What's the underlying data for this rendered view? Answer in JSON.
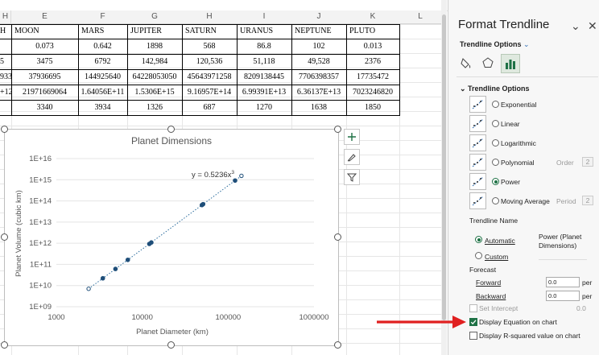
{
  "columns": [
    "H",
    "E",
    "F",
    "G",
    "H",
    "I",
    "J",
    "K",
    "L"
  ],
  "table": {
    "headers": [
      "H",
      "MOON",
      "MARS",
      "JUPITER",
      "SATURN",
      "URANUS",
      "NEPTUNE",
      "PLUTO"
    ],
    "rows": [
      [
        "",
        "0.073",
        "0.642",
        "1898",
        "568",
        "86.8",
        "102",
        "0.013"
      ],
      [
        "5",
        "3475",
        "6792",
        "142,984",
        "120,536",
        "51,118",
        "49,528",
        "2376"
      ],
      [
        "933",
        "37936695",
        "144925640",
        "64228053050",
        "45643971258",
        "8209138445",
        "7706398357",
        "17735472"
      ],
      [
        "+12",
        "21971669064",
        "1.64056E+11",
        "1.5306E+15",
        "9.16957E+14",
        "6.99391E+13",
        "6.36137E+13",
        "7023246820"
      ],
      [
        "",
        "3340",
        "3934",
        "1326",
        "687",
        "1270",
        "1638",
        "1850"
      ]
    ]
  },
  "chart": {
    "title": "Planet Dimensions",
    "equation": "y = 0.5236x",
    "equation_exp": "3",
    "xlabel": "Planet Diameter (km)",
    "ylabel": "Planet Volume (cubic km)"
  },
  "chart_data": {
    "type": "scatter",
    "title": "Planet Dimensions",
    "xlabel": "Planet Diameter (km)",
    "ylabel": "Planet Volume (cubic km)",
    "x_scale": "log",
    "y_scale": "log",
    "xlim": [
      1000,
      1000000
    ],
    "ylim": [
      1000000000,
      10000000000000000
    ],
    "x_ticks": [
      "1000",
      "10000",
      "100000",
      "1000000"
    ],
    "y_ticks": [
      "1E+09",
      "1E+10",
      "1E+11",
      "1E+12",
      "1E+13",
      "1E+14",
      "1E+15",
      "1E+16"
    ],
    "series": [
      {
        "x": [
          2376,
          3475,
          4879,
          6792,
          12104,
          12756,
          49528,
          51118,
          120536,
          142984
        ],
        "y": [
          7023246820,
          21971669064,
          60827208742,
          164056000000,
          928415345893,
          1083206916846,
          63613700000000,
          69939100000000,
          916957000000000,
          1530600000000000
        ]
      }
    ],
    "trendline": {
      "type": "power",
      "equation": "y = 0.5236x3"
    },
    "grid": true
  },
  "chart_tools": {
    "add_icon": "plus-icon",
    "style_icon": "brush-icon",
    "filter_icon": "filter-icon"
  },
  "pane": {
    "title": "Format Trendline",
    "dropdown_label": "Trendline Options",
    "section_label": "Trendline Options",
    "types": [
      {
        "label": "Exponential",
        "selected": false
      },
      {
        "label": "Linear",
        "selected": false
      },
      {
        "label": "Logarithmic",
        "selected": false
      },
      {
        "label": "Polynomial",
        "selected": false,
        "extra_label": "Order",
        "extra_value": "2"
      },
      {
        "label": "Power",
        "selected": true
      },
      {
        "label": "Moving Average",
        "selected": false,
        "extra_label": "Period",
        "extra_value": "2"
      }
    ],
    "name_label": "Trendline Name",
    "automatic_label": "Automatic",
    "automatic_value": "Power (Planet Dimensions)",
    "custom_label": "Custom",
    "forecast_label": "Forecast",
    "forward_label": "Forward",
    "forward_value": "0.0",
    "forward_unit": "per",
    "backward_label": "Backward",
    "backward_value": "0.0",
    "backward_unit": "per",
    "set_intercept_label": "Set Intercept",
    "set_intercept_value": "0.0",
    "display_equation_label": "Display Equation on chart",
    "display_equation_checked": true,
    "display_rsquared_label": "Display R-squared value on chart",
    "display_rsquared_checked": false
  },
  "colors": {
    "accent": "#1e7145",
    "series": "#1f4e79",
    "arrow": "#e02020"
  }
}
